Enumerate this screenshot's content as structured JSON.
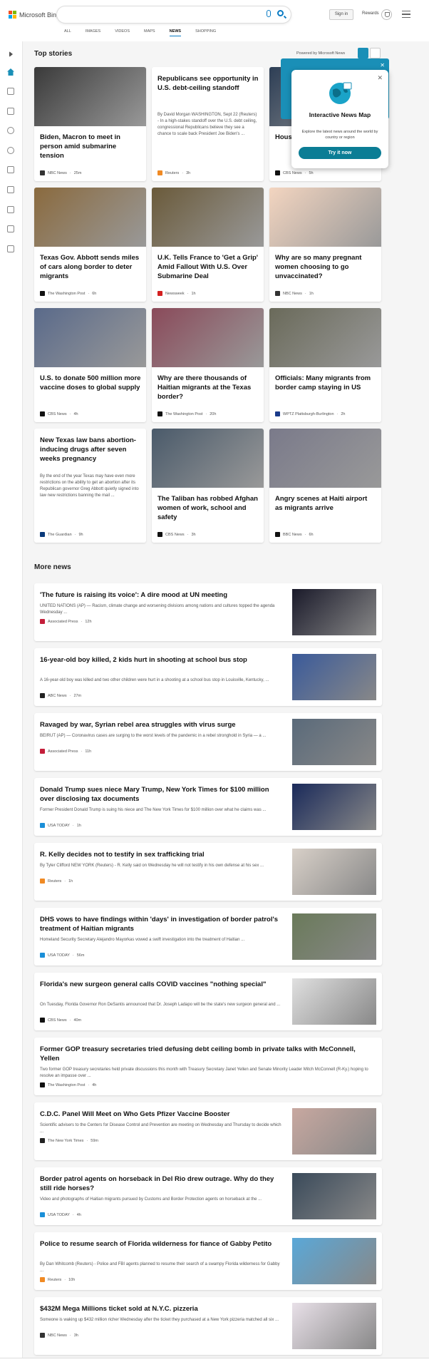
{
  "header": {
    "brand": "Microsoft Bing",
    "search_placeholder": "",
    "signin": "Sign in",
    "rewards": "Rewards",
    "tabs": [
      "ALL",
      "IMAGES",
      "VIDEOS",
      "MAPS",
      "NEWS",
      "SHOPPING"
    ],
    "active_tab": "NEWS"
  },
  "sidebar": {
    "icons": [
      "expand-icon",
      "home-icon",
      "tools-icon",
      "flag-icon",
      "location-pin-icon",
      "globe-icon",
      "business-icon",
      "rocket-icon",
      "entertainment-icon",
      "politics-icon",
      "card-icon"
    ]
  },
  "top_stories": {
    "heading": "Top stories",
    "powered_by": "Powered by Microsoft News",
    "cards": [
      {
        "title": "Biden, Macron to meet in person amid submarine tension",
        "snippet": "",
        "source": "NBC News",
        "time": "25m",
        "img": "#3a3a3a",
        "logo": "#333"
      },
      {
        "title": "Republicans see opportunity in U.S. debt-ceiling standoff",
        "snippet": "By David Morgan WASHINGTON, Sept 22 (Reuters) - In a high-stakes standoff over the U.S. debt ceiling, congressional Republicans believe they see a chance to scale back President Joe Biden's ...",
        "source": "Reuters",
        "time": "3h",
        "img": "",
        "logo": "#f08a24"
      },
      {
        "title": "Hous to av debt",
        "snippet": "",
        "source": "CBS News",
        "time": "5h",
        "img": "#2d3e55",
        "logo": "#111"
      },
      {
        "title": "Texas Gov. Abbott sends miles of cars along border to deter migrants",
        "snippet": "",
        "source": "The Washington Post",
        "time": "6h",
        "img": "#8a6a3e",
        "logo": "#111"
      },
      {
        "title": "U.K. Tells France to 'Get a Grip' Amid Fallout With U.S. Over Submarine Deal",
        "snippet": "",
        "source": "Newsweek",
        "time": "1h",
        "img": "#6a5a3a",
        "logo": "#d32020"
      },
      {
        "title": "Why are so many pregnant women choosing to go unvaccinated?",
        "snippet": "",
        "source": "NBC News",
        "time": "1h",
        "img": "#f3d5c0",
        "logo": "#333"
      },
      {
        "title": "U.S. to donate 500 million more vaccine doses to global supply",
        "snippet": "",
        "source": "CBS News",
        "time": "4h",
        "img": "#5a6a8a",
        "logo": "#111"
      },
      {
        "title": "Why are there thousands of Haitian migrants at the Texas border?",
        "snippet": "",
        "source": "The Washington Post",
        "time": "20h",
        "img": "#8a4a5a",
        "logo": "#111"
      },
      {
        "title": "Officials: Many migrants from border camp staying in US",
        "snippet": "",
        "source": "WPTZ Plattsburgh-Burlington",
        "time": "2h",
        "img": "#6a6a5a",
        "logo": "#1a3a8a"
      },
      {
        "title": "New Texas law bans abortion-inducing drugs after seven weeks pregnancy",
        "snippet": "By the end of the year Texas may have even more restrictions on the ability to get an abortion after its Republican governor Greg Abbott quietly signed into law new restrictions banning the mail ...",
        "source": "The Guardian",
        "time": "9h",
        "img": "",
        "logo": "#0a3a7a"
      },
      {
        "title": "The Taliban has robbed Afghan women of work, school and safety",
        "snippet": "",
        "source": "CBS News",
        "time": "3h",
        "img": "#4a5a6a",
        "logo": "#111"
      },
      {
        "title": "Angry scenes at Haiti airport as migrants arrive",
        "snippet": "",
        "source": "BBC News",
        "time": "6h",
        "img": "#7a7a8a",
        "logo": "#111"
      }
    ]
  },
  "popup": {
    "title": "Interactive News Map",
    "description": "Explore the latest news around the world by country or region",
    "button": "Try it now"
  },
  "more_news": {
    "heading": "More news",
    "items": [
      {
        "title": "'The future is raising its voice': A dire mood at UN meeting",
        "snippet": "UNITED NATIONS (AP) — Racism, climate change and worsening divisions among nations and cultures topped the agenda Wednesday ...",
        "source": "Associated Press",
        "time": "12h",
        "img": "#1a1a2a",
        "logo": "#c41e3a"
      },
      {
        "title": "16-year-old boy killed, 2 kids hurt in shooting at school bus stop",
        "snippet": "A 16-year-old boy was killed and two other children were hurt in a shooting at a school bus stop in Louisville, Kentucky, ...",
        "source": "ABC News",
        "time": "27m",
        "img": "#3a5a9a",
        "logo": "#222"
      },
      {
        "title": "Ravaged by war, Syrian rebel area struggles with virus surge",
        "snippet": "BEIRUT (AP) — Coronavirus cases are surging to the worst levels of the pandemic in a rebel stronghold in Syria — a ...",
        "source": "Associated Press",
        "time": "11h",
        "img": "#5a6a7a",
        "logo": "#c41e3a"
      },
      {
        "title": "Donald Trump sues niece Mary Trump, New York Times for $100 million over disclosing tax documents",
        "snippet": "Former President Donald Trump is suing his niece and The New York Times for $100 million over what he claims was ...",
        "source": "USA TODAY",
        "time": "1h",
        "img": "#1a2a5a",
        "logo": "#1a8fd8"
      },
      {
        "title": "R. Kelly decides not to testify in sex trafficking trial",
        "snippet": "By Tyler Clifford NEW YORK (Reuters) - R. Kelly said on Wednesday he will not testify in his own defense at his sex ...",
        "source": "Reuters",
        "time": "1h",
        "img": "#d8d0c8",
        "logo": "#f08a24"
      },
      {
        "title": "DHS vows to have findings within 'days' in investigation of border patrol's treatment of Haitian migrants",
        "snippet": "Homeland Security Secretary Alejandro Mayorkas vowed a swift investigation into the treatment of Haitian ...",
        "source": "USA TODAY",
        "time": "56m",
        "img": "#6a7a5a",
        "logo": "#1a8fd8"
      },
      {
        "title": "Florida's new surgeon general calls COVID vaccines \"nothing special\"",
        "snippet": "On Tuesday, Florida Governor Ron DeSantis announced that Dr. Joseph Ladapo will be the state's new surgeon general and ...",
        "source": "CBS News",
        "time": "40m",
        "img": "#e0e0e0",
        "logo": "#111"
      },
      {
        "title": "Former GOP treasury secretaries tried defusing debt ceiling bomb in private talks with McConnell, Yellen",
        "snippet": "Two former GOP treasury secretaries held private discussions this month with Treasury Secretary Janet Yellen and Senate Minority Leader Mitch McConnell (R-Ky.) hoping to resolve an impasse over ...",
        "source": "The Washington Post",
        "time": "4h",
        "img": "",
        "logo": "#111"
      },
      {
        "title": "C.D.C. Panel Will Meet on Who Gets Pfizer Vaccine Booster",
        "snippet": "Scientific advisers to the Centers for Disease Control and Prevention are meeting on Wednesday and Thursday to decide which ...",
        "source": "The New York Times",
        "time": "59m",
        "img": "#c8a8a0",
        "logo": "#222"
      },
      {
        "title": "Border patrol agents on horseback in Del Rio drew outrage. Why do they still ride horses?",
        "snippet": "Video and photographs of Haitian migrants pursued by Customs and Border Protection agents on horseback at the ...",
        "source": "USA TODAY",
        "time": "4h",
        "img": "#3a4a5a",
        "logo": "#1a8fd8"
      },
      {
        "title": "Police to resume search of Florida wilderness for fiance of Gabby Petito",
        "snippet": "By Dan Whitcomb (Reuters) - Police and FBI agents planned to resume their search of a swampy Florida wilderness for Gabby ...",
        "source": "Reuters",
        "time": "10h",
        "img": "#5aa8d8",
        "logo": "#f08a24"
      },
      {
        "title": "$432M Mega Millions ticket sold at N.Y.C. pizzeria",
        "snippet": "Someone is waking up $432 million richer Wednesday after the ticket they purchased at a New York pizzeria matched all six ...",
        "source": "NBC News",
        "time": "3h",
        "img": "#e8e0e8",
        "logo": "#333"
      }
    ]
  }
}
